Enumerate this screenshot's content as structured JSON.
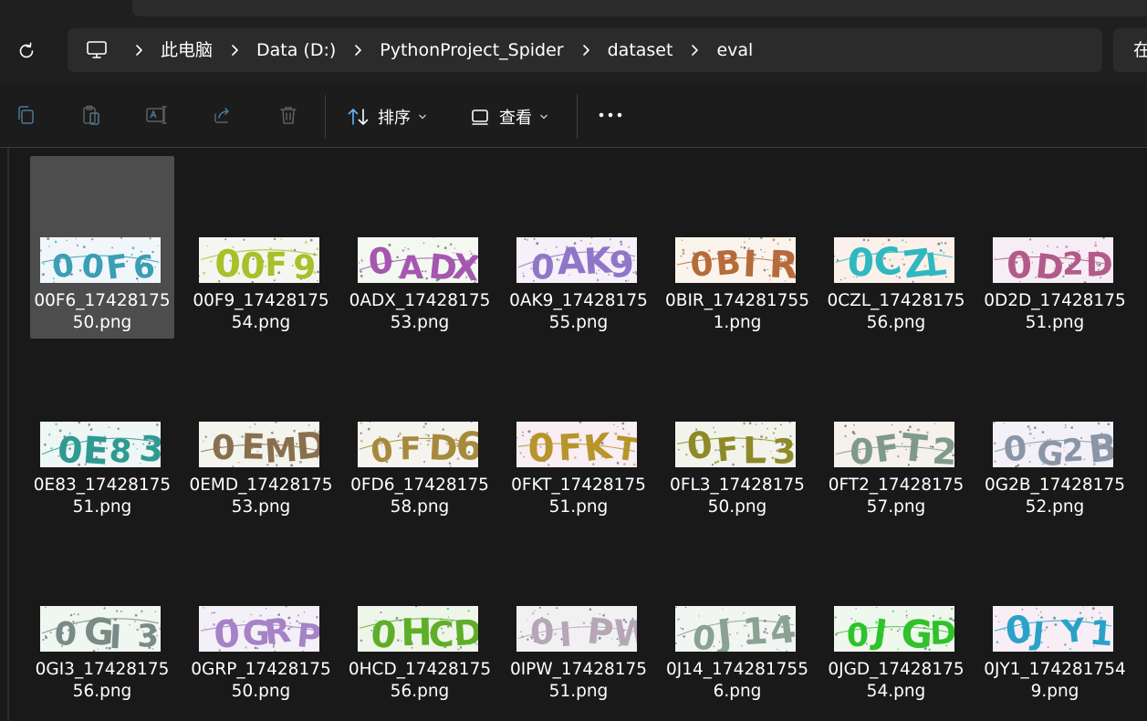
{
  "breadcrumb": {
    "items": [
      "此电脑",
      "Data (D:)",
      "PythonProject_Spider",
      "dataset",
      "eval"
    ]
  },
  "search": {
    "partial_text": "在"
  },
  "toolbar": {
    "sort_label": "排序",
    "view_label": "查看"
  },
  "icons": {
    "refresh": "refresh-icon",
    "pc": "computer-icon",
    "copy": "copy-icon",
    "paste": "paste-icon",
    "rename": "rename-icon",
    "share": "share-icon",
    "delete": "delete-icon",
    "sort": "sort-icon",
    "view": "view-icon",
    "more": "more-icon"
  },
  "files": [
    {
      "name": "00F6_1742817550.png",
      "captcha": "00F6",
      "ink": "#3a9fb4",
      "bg": "#f1f6fa",
      "selected": true
    },
    {
      "name": "00F9_1742817554.png",
      "captcha": "00F9",
      "ink": "#a9c02a",
      "bg": "#f4f7ef"
    },
    {
      "name": "0ADX_1742817553.png",
      "captcha": "0ADX",
      "ink": "#a557b0",
      "bg": "#f3f8f1"
    },
    {
      "name": "0AK9_1742817555.png",
      "captcha": "0AK9",
      "ink": "#8f76c8",
      "bg": "#f6f0f8"
    },
    {
      "name": "0BIR_1742817551.png",
      "captcha": "0BIR",
      "ink": "#b56b3a",
      "bg": "#fbf4ec"
    },
    {
      "name": "0CZL_1742817556.png",
      "captcha": "0CZL",
      "ink": "#2fb8bf",
      "bg": "#fbf0ea"
    },
    {
      "name": "0D2D_1742817551.png",
      "captcha": "0D2D",
      "ink": "#b25b8a",
      "bg": "#f6eef4"
    },
    {
      "name": "0E83_1742817551.png",
      "captcha": "0E83",
      "ink": "#2f9a92",
      "bg": "#eef7f5"
    },
    {
      "name": "0EMD_1742817553.png",
      "captcha": "0EMD",
      "ink": "#8a6f4e",
      "bg": "#f3f4ee"
    },
    {
      "name": "0FD6_1742817558.png",
      "captcha": "0FD6",
      "ink": "#a68a3c",
      "bg": "#f4f3ee"
    },
    {
      "name": "0FKT_1742817551.png",
      "captcha": "0FKT",
      "ink": "#b8952a",
      "bg": "#f8eef4"
    },
    {
      "name": "0FL3_1742817550.png",
      "captcha": "0FL3",
      "ink": "#8f8a28",
      "bg": "#f2f4ec"
    },
    {
      "name": "0FT2_1742817557.png",
      "captcha": "0FT2",
      "ink": "#7f9a8a",
      "bg": "#f6f1ea"
    },
    {
      "name": "0G2B_1742817552.png",
      "captcha": "0G2B",
      "ink": "#8a96a6",
      "bg": "#f3f0f8"
    },
    {
      "name": "0GI3_1742817556.png",
      "captcha": "0GI3",
      "ink": "#7a8a86",
      "bg": "#f0f6f0"
    },
    {
      "name": "0GRP_1742817550.png",
      "captcha": "0GRP",
      "ink": "#a583c6",
      "bg": "#f4f0f8"
    },
    {
      "name": "0HCD_1742817556.png",
      "captcha": "0HCD",
      "ink": "#5fae2a",
      "bg": "#eef6ea"
    },
    {
      "name": "0IPW_1742817551.png",
      "captcha": "0IPW",
      "ink": "#b6a6b8",
      "bg": "#f1f1f2"
    },
    {
      "name": "0J14_1742817556.png",
      "captcha": "0J14",
      "ink": "#8aa294",
      "bg": "#f2f6f2"
    },
    {
      "name": "0JGD_1742817554.png",
      "captcha": "0JGD",
      "ink": "#2fc22a",
      "bg": "#eef8ec"
    },
    {
      "name": "0JY1_1742817549.png",
      "captcha": "0JY1",
      "ink": "#2aa2c8",
      "bg": "#f7eef6"
    }
  ]
}
